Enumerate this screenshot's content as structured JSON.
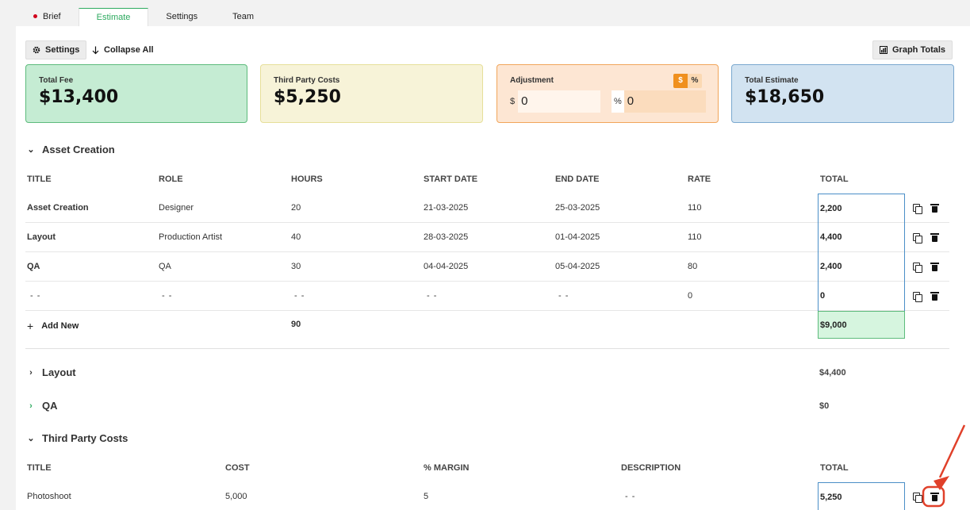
{
  "tabs": [
    {
      "label": "Brief",
      "has_dot": true
    },
    {
      "label": "Estimate",
      "active": true
    },
    {
      "label": "Settings"
    },
    {
      "label": "Team"
    }
  ],
  "toolbar": {
    "settings_label": "Settings",
    "collapse_label": "Collapse All",
    "graph_label": "Graph Totals"
  },
  "cards": {
    "fee": {
      "label": "Total Fee",
      "value": "$13,400"
    },
    "third_party": {
      "label": "Third Party Costs",
      "value": "$5,250"
    },
    "adjustment": {
      "label": "Adjustment",
      "toggle_dollar": "$",
      "toggle_percent": "%",
      "dollar_prefix": "$",
      "dollar_value": "0",
      "percent_prefix": "%",
      "percent_value": "0"
    },
    "total": {
      "label": "Total Estimate",
      "value": "$18,650"
    }
  },
  "asset_section": {
    "title": "Asset Creation",
    "headers": [
      "TITLE",
      "ROLE",
      "HOURS",
      "START DATE",
      "END DATE",
      "RATE",
      "TOTAL"
    ],
    "rows": [
      {
        "title": "Asset Creation",
        "role": "Designer",
        "hours": "20",
        "start": "21-03-2025",
        "end": "25-03-2025",
        "rate": "110",
        "total": "2,200"
      },
      {
        "title": "Layout",
        "role": "Production Artist",
        "hours": "40",
        "start": "28-03-2025",
        "end": "01-04-2025",
        "rate": "110",
        "total": "4,400"
      },
      {
        "title": "QA",
        "role": "QA",
        "hours": "30",
        "start": "04-04-2025",
        "end": "05-04-2025",
        "rate": "80",
        "total": "2,400"
      },
      {
        "title": "- -",
        "role": "- -",
        "hours": "- -",
        "start": "- -",
        "end": "- -",
        "rate": "0",
        "total": "0"
      }
    ],
    "add_new_label": "Add New",
    "hours_sum": "90",
    "total_sum": "$9,000"
  },
  "collapsed_sections": [
    {
      "title": "Layout",
      "total": "$4,400"
    },
    {
      "title": "QA",
      "total": "$0"
    }
  ],
  "third_party_section": {
    "title": "Third Party Costs",
    "headers": [
      "TITLE",
      "COST",
      "% MARGIN",
      "DESCRIPTION",
      "TOTAL"
    ],
    "rows": [
      {
        "title": "Photoshoot",
        "cost": "5,000",
        "margin": "5",
        "description": "- -",
        "total": "5,250"
      }
    ]
  },
  "colors": {
    "accent_green": "#2daa5f",
    "fee_bg": "#c5ecd3",
    "third_bg": "#f7f3d8",
    "adjust_bg": "#fde6d3",
    "total_bg": "#d2e3f1",
    "annotation_red": "#e0402a"
  },
  "icons": [
    "gear-icon",
    "arrow-down-icon",
    "graph-icon",
    "copy-icon",
    "trash-icon",
    "chevron-down-icon",
    "chevron-right-icon",
    "plus-icon"
  ]
}
